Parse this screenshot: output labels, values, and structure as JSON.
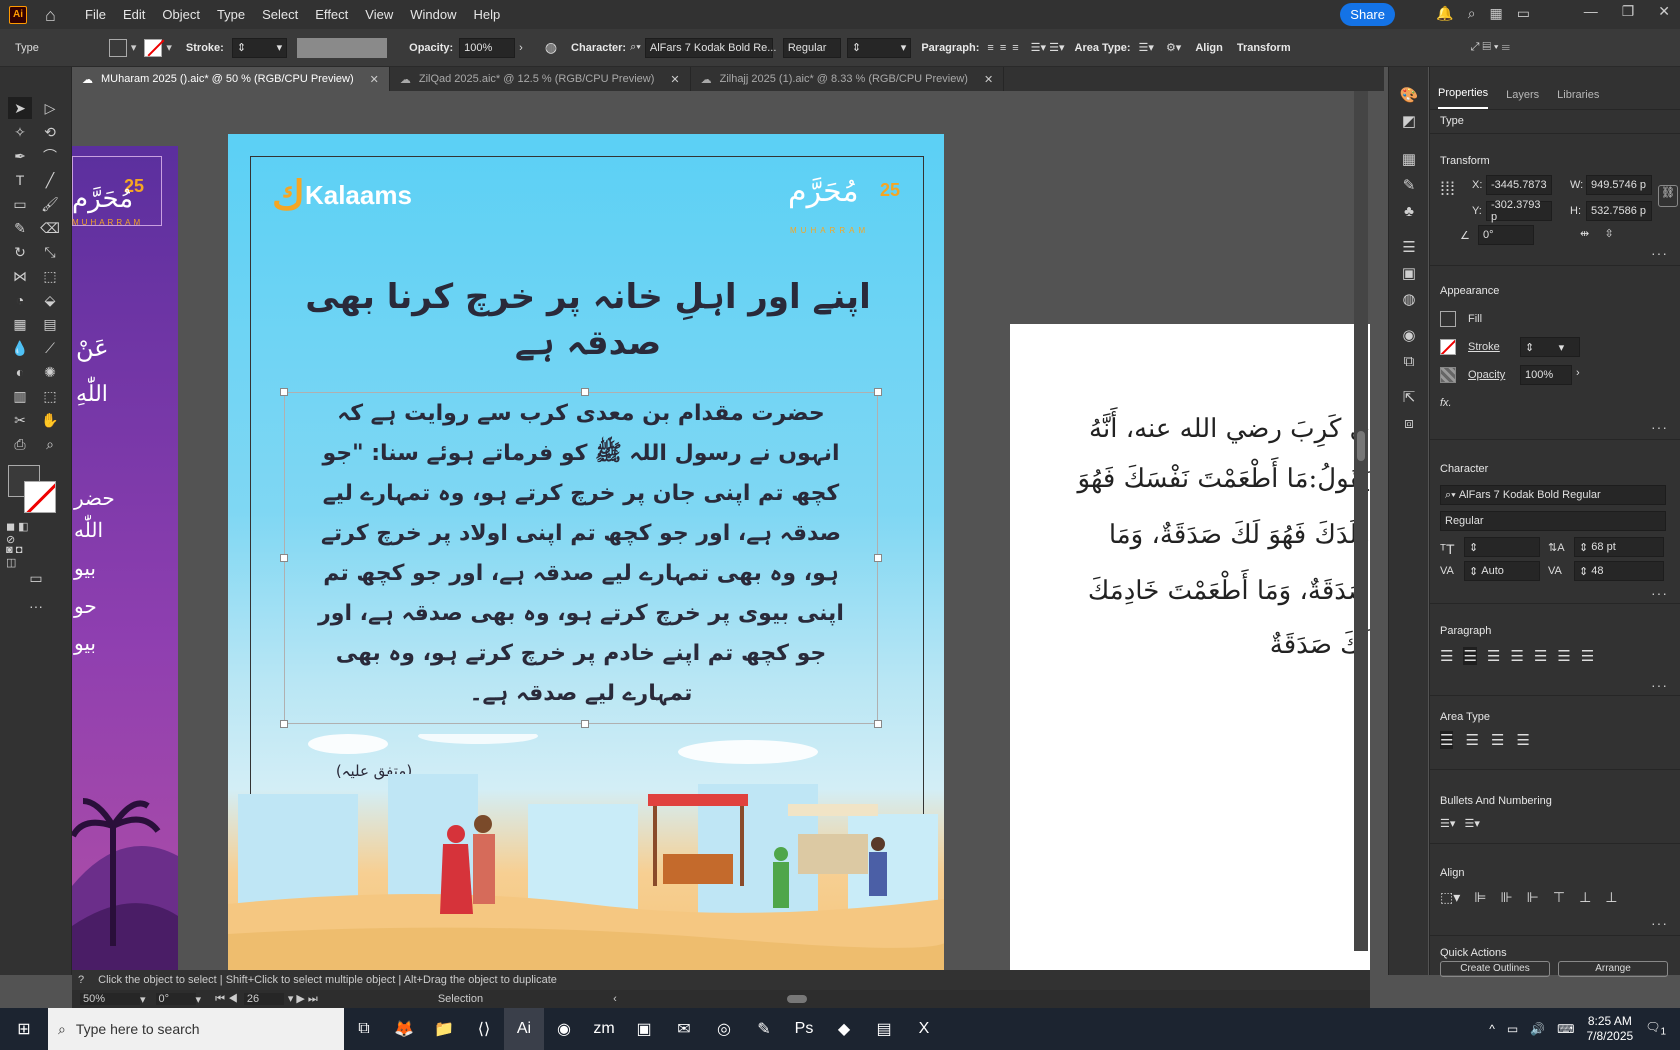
{
  "app": {
    "logo": "Ai"
  },
  "menu": [
    "File",
    "Edit",
    "Object",
    "Type",
    "Select",
    "Effect",
    "View",
    "Window",
    "Help"
  ],
  "share_label": "Share",
  "control": {
    "type_label": "Type",
    "stroke_label": "Stroke:",
    "opacity_label": "Opacity:",
    "opacity_value": "100%",
    "character_label": "Character:",
    "font_name": "AlFars 7 Kodak Bold Re...",
    "font_style": "Regular",
    "paragraph_label": "Paragraph:",
    "area_type_label": "Area Type:",
    "align_label": "Align",
    "transform_label": "Transform"
  },
  "tabs": [
    {
      "label": "MUharam 2025 ().aic* @ 50 % (RGB/CPU Preview)"
    },
    {
      "label": "ZilQad 2025.aic* @ 12.5 % (RGB/CPU Preview)"
    },
    {
      "label": "Zilhajj 2025 (1).aic* @ 8.33 % (RGB/CPU Preview)"
    }
  ],
  "artboard": {
    "brand": "Kalaams",
    "muharram_num": "25",
    "muharram_ar": "مُحَرَّم",
    "muharram_en": "MUHARRAM",
    "title_line1": "اپنے اور اہلِ خانہ پر خرچ کرنا بھی",
    "title_line2": "صدقہ ہے",
    "body_lines": [
      "حضرت مقدام بن معدی کرب سے روایت ہے کہ",
      "انہوں نے رسول اللہ ﷺ کو فرماتے ہوئے سنا: \"جو",
      "کچھ تم اپنی جان پر خرچ کرتے ہو، وہ تمہارے لیے",
      "صدقہ ہے، اور جو کچھ تم اپنی اولاد پر خرچ کرتے",
      "ہو، وہ بھی تمہارے لیے صدقہ ہے، اور جو کچھ تم",
      "اپنی بیوی پر خرچ کرتے ہو، وہ بھی صدقہ ہے، اور",
      "جو کچھ تم اپنے خادم پر خرچ کرتے ہو، وہ بھی",
      "تمہارے لیے صدقہ ہے۔"
    ],
    "reference": "(متفق علیہ)"
  },
  "left_artboard": {
    "num": "25",
    "title": "مُحَرَّم",
    "sub": "MUHARRAM",
    "lines": [
      "عَنْ",
      "اللّٰهِ",
      "حضر",
      "اللّٰه",
      "بیو",
      "حو",
      "بیو"
    ]
  },
  "right_artboard": {
    "lines": [
      "ي كَرِبَ رضي الله عنه، أَنَّهُ",
      "يَقُولُ:مَا أَطْعَمْتَ نَفْسَكَ فَهُوَ",
      "وَلَدَكَ فَهُوَ لَكَ صَدَقَةٌ، وَمَا",
      "صَدَقَةٌ، وَمَا أَطْعَمْتَ خَادِمَكَ",
      "لَكَ صَدَقَةٌ"
    ]
  },
  "properties": {
    "tabs": [
      "Properties",
      "Layers",
      "Libraries"
    ],
    "type_label": "Type",
    "transform_title": "Transform",
    "x_label": "X:",
    "x_value": "-3445.7873",
    "y_label": "Y:",
    "y_value": "-302.3793 p",
    "w_label": "W:",
    "w_value": "949.5746 p",
    "h_label": "H:",
    "h_value": "532.7586 p",
    "angle_value": "0°",
    "appearance_title": "Appearance",
    "fill_label": "Fill",
    "stroke_label": "Stroke",
    "opacity_label": "Opacity",
    "opacity_value": "100%",
    "fx_label": "fx.",
    "character_title": "Character",
    "font_name": "AlFars 7 Kodak Bold Regular",
    "font_style": "Regular",
    "leading_value": "68 pt",
    "kerning_value": "Auto",
    "tracking_value": "48",
    "paragraph_title": "Paragraph",
    "area_type_title": "Area Type",
    "bullets_title": "Bullets And Numbering",
    "align_title": "Align",
    "quick_actions_title": "Quick Actions",
    "create_outlines_label": "Create Outlines",
    "arrange_label": "Arrange"
  },
  "status": {
    "hint": "Click the object to select  |  Shift+Click to select multiple object  |  Alt+Drag the object to duplicate",
    "zoom": "50%",
    "rotation": "0°",
    "artboard_num": "26",
    "mode": "Selection"
  },
  "taskbar": {
    "search_placeholder": "Type here to search",
    "time": "8:25 AM",
    "date": "7/8/2025",
    "notif_count": "1"
  }
}
